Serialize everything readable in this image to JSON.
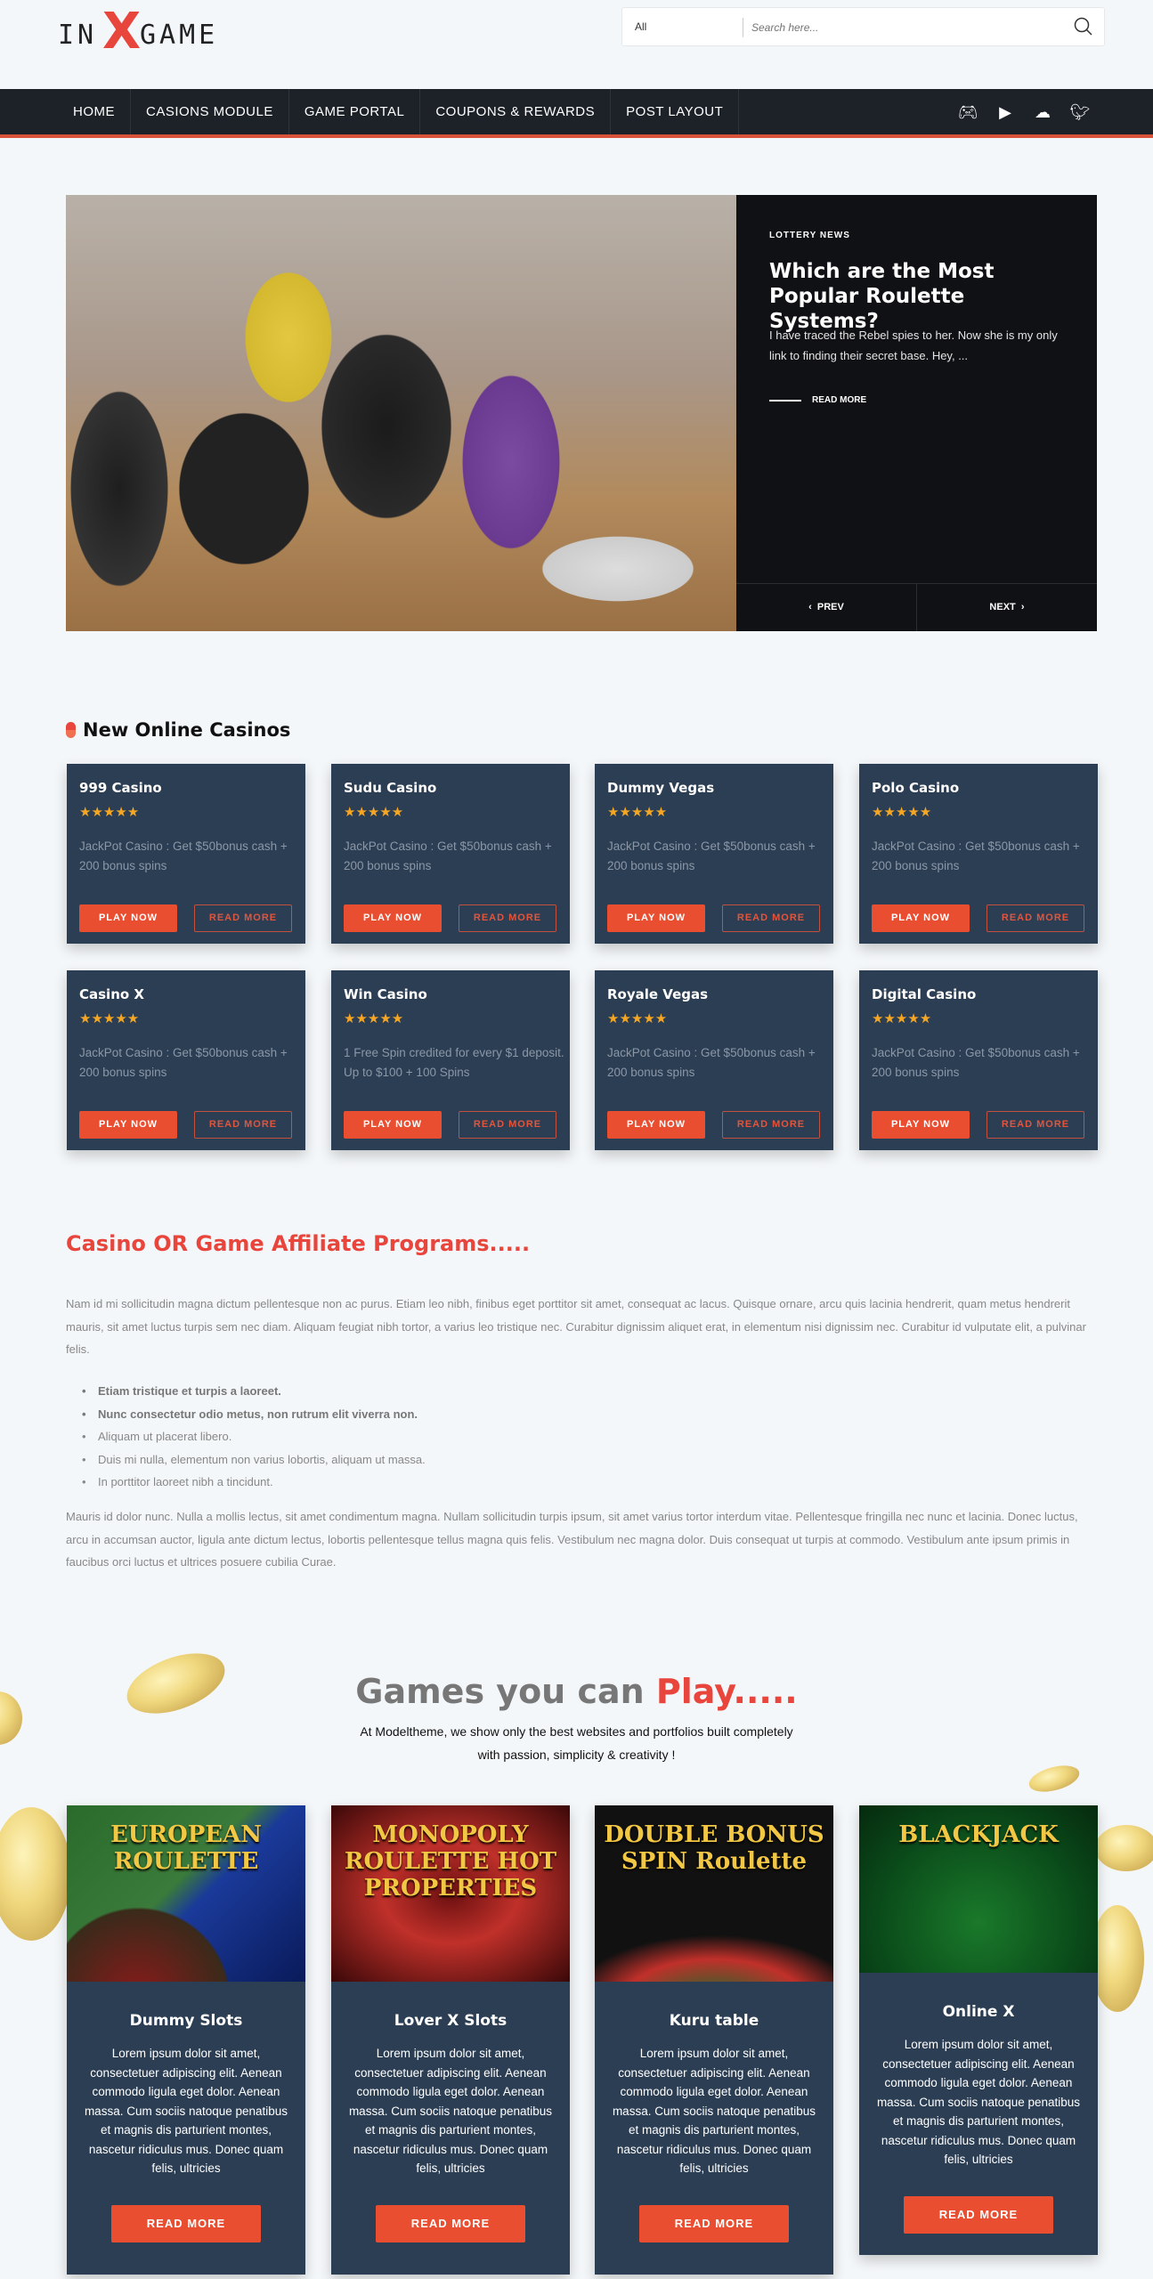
{
  "header": {
    "logo_text": "INXGAME",
    "search": {
      "category": "All",
      "placeholder": "Search here..."
    }
  },
  "nav": {
    "items": [
      "HOME",
      "CASIONS MODULE",
      "GAME PORTAL",
      "COUPONS & REWARDS",
      "POST LAYOUT"
    ],
    "social_icons": [
      "gamepad-icon",
      "youtube-icon",
      "soundcloud-icon",
      "twitter-icon"
    ]
  },
  "hero": {
    "category": "LOTTERY NEWS",
    "title": "Which are the Most Popular Roulette Systems?",
    "excerpt": "I have traced the Rebel spies to her. Now she is my only link to finding their secret base. Hey, ...",
    "read_more": "READ MORE",
    "prev": "PREV",
    "next": "NEXT"
  },
  "casinos": {
    "title": "New Online Casinos",
    "play_label": "PLAY NOW",
    "read_label": "READ MORE",
    "rating": 5,
    "items": [
      {
        "name": "999 Casino",
        "desc": "JackPot Casino : Get $50bonus cash + 200 bonus spins"
      },
      {
        "name": "Sudu Casino",
        "desc": "JackPot Casino : Get $50bonus cash + 200 bonus spins"
      },
      {
        "name": "Dummy Vegas",
        "desc": "JackPot Casino : Get $50bonus cash + 200 bonus spins"
      },
      {
        "name": "Polo Casino",
        "desc": "JackPot Casino : Get $50bonus cash + 200 bonus spins"
      },
      {
        "name": "Casino X",
        "desc": "JackPot Casino : Get $50bonus cash + 200 bonus spins"
      },
      {
        "name": "Win Casino",
        "desc": "1 Free Spin credited for every $1 deposit. Up to $100 + 100 Spins"
      },
      {
        "name": "Royale Vegas",
        "desc": "JackPot Casino : Get $50bonus cash + 200 bonus spins"
      },
      {
        "name": "Digital Casino",
        "desc": "JackPot Casino : Get $50bonus cash + 200 bonus spins"
      }
    ]
  },
  "affiliate": {
    "title": "Casino OR Game Affiliate Programs.....",
    "para1": "Nam id mi sollicitudin magna dictum pellentesque non ac purus. Etiam leo nibh, finibus eget porttitor sit amet, consequat ac lacus. Quisque ornare, arcu quis lacinia hendrerit, quam metus hendrerit mauris, sit amet luctus turpis sem nec diam. Aliquam feugiat nibh tortor, a varius leo tristique nec. Curabitur dignissim aliquet erat, in elementum nisi dignissim nec. Curabitur id vulputate elit, a pulvinar felis.",
    "list": [
      "Etiam tristique et turpis a laoreet.",
      "Nunc consectetur odio metus, non rutrum elit viverra non.",
      "Aliquam ut placerat libero.",
      "Duis mi nulla, elementum non varius lobortis, aliquam ut massa.",
      "In porttitor laoreet nibh a tincidunt."
    ],
    "para2": "Mauris id dolor nunc. Nulla a mollis lectus, sit amet condimentum magna. Nullam sollicitudin turpis ipsum, sit amet varius tortor interdum vitae. Pellentesque fringilla nec nunc et lacinia. Donec luctus, arcu in accumsan auctor, ligula ante dictum lectus, lobortis pellentesque tellus magna quis felis. Vestibulum nec magna dolor. Duis consequat ut turpis at commodo. Vestibulum ante ipsum primis in faucibus orci luctus et ultrices posuere cubilia Curae."
  },
  "games": {
    "title_prefix": "Games you can ",
    "title_highlight": "Play.....",
    "subtitle": "At Modeltheme, we show only the best websites and portfolios built completely with passion, simplicity & creativity !",
    "button": "READ MORE",
    "items": [
      {
        "name": "Dummy Slots",
        "image_text": "EUROPEAN ROULETTE",
        "desc": "Lorem ipsum dolor sit amet, consectetuer adipiscing elit. Aenean commodo ligula eget dolor. Aenean massa. Cum sociis natoque penatibus et magnis dis parturient montes, nascetur ridiculus mus. Donec quam felis, ultricies"
      },
      {
        "name": "Lover X Slots",
        "image_text": "MONOPOLY ROULETTE HOT PROPERTIES",
        "desc": "Lorem ipsum dolor sit amet, consectetuer adipiscing elit. Aenean commodo ligula eget dolor. Aenean massa. Cum sociis natoque penatibus et magnis dis parturient montes, nascetur ridiculus mus. Donec quam felis, ultricies"
      },
      {
        "name": "Kuru table",
        "image_text": "DOUBLE BONUS SPIN Roulette",
        "desc": "Lorem ipsum dolor sit amet, consectetuer adipiscing elit. Aenean commodo ligula eget dolor. Aenean massa. Cum sociis natoque penatibus et magnis dis parturient montes, nascetur ridiculus mus. Donec quam felis, ultricies"
      },
      {
        "name": "Online X",
        "image_text": "BLACKJACK",
        "desc": "Lorem ipsum dolor sit amet, consectetuer adipiscing elit. Aenean commodo ligula eget dolor. Aenean massa. Cum sociis natoque penatibus et magnis dis parturient montes, nascetur ridiculus mus. Donec quam felis, ultricies"
      }
    ]
  },
  "colors": {
    "accent": "#ea4e30",
    "nav_bg": "#1d2229",
    "card_bg": "#2c3e54",
    "star": "#f5a623"
  }
}
